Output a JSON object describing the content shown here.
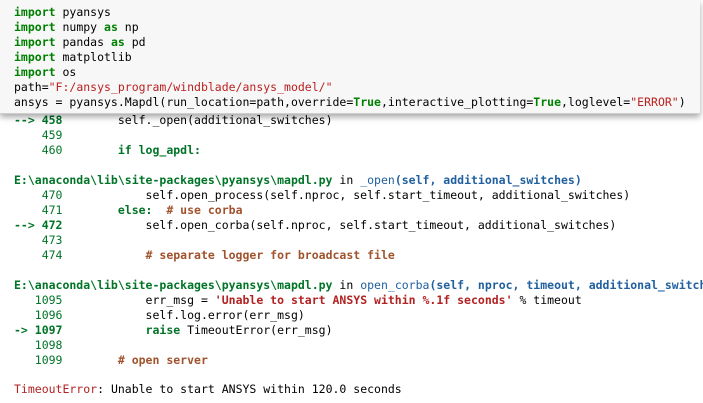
{
  "code_cell": {
    "lines": [
      {
        "kw": "import",
        "rest": " pyansys"
      },
      {
        "kw": "import",
        "rest": " numpy ",
        "kw2": "as",
        "rest2": " np"
      },
      {
        "kw": "import",
        "rest": " pandas ",
        "kw2": "as",
        "rest2": " pd"
      },
      {
        "kw": "import",
        "rest": " matplotlib"
      },
      {
        "kw": "import",
        "rest": " os"
      }
    ],
    "path_line": {
      "lhs": "path=",
      "str": "\"F:/ansys_program/windblade/ansys_model/\""
    },
    "mapdl_line": {
      "p1": "ansys = pyansys.Mapdl(run_location=path,override=",
      "c1": "True",
      "p2": ",interactive_plotting=",
      "c2": "True",
      "p3": ",loglevel=",
      "s1": "\"ERROR\"",
      "p4": ")"
    }
  },
  "traceback": {
    "frame0": {
      "partial_arrow": "--> 458",
      "partial_code": "        self._open(additional_switches)",
      "l459": "    459",
      "l460": "    460",
      "l460_code": "        if log_apdl:"
    },
    "frame1": {
      "path": "E:\\anaconda\\lib\\site-packages\\pyansys\\mapdl.py",
      "in": " in ",
      "func": "_open",
      "sig": "(self, additional_switches)",
      "l470": "    470",
      "l470_code": "            self.open_process(self.nproc, self.start_timeout, additional_switches)",
      "l471": "    471",
      "l471_kw": "        else:",
      "l471_comment": "  # use corba",
      "l472_arrow": "--> 472",
      "l472_code": "            self.open_corba(self.nproc, self.start_timeout, additional_switches)",
      "l473": "    473",
      "l474": "    474",
      "l474_comment": "            # separate logger for broadcast file"
    },
    "frame2": {
      "path": "E:\\anaconda\\lib\\site-packages\\pyansys\\mapdl.py",
      "in": " in ",
      "func": "open_corba",
      "sig": "(self, nproc, timeout, additional_switches)",
      "l1095": "   1095",
      "l1095_a": "            err_msg = ",
      "l1095_str": "'Unable to start ANSYS within %.1f seconds'",
      "l1095_b": " % timeout",
      "l1096": "   1096",
      "l1096_code": "            self.log.error(err_msg)",
      "l1097_arrow": "-> 1097",
      "l1097_kw": "            raise",
      "l1097_code": " TimeoutError(err_msg)",
      "l1098": "   1098",
      "l1099": "   1099",
      "l1099_comment": "        # open server"
    },
    "error": {
      "name": "TimeoutError",
      "message": ": Unable to start ANSYS within 120.0 seconds"
    }
  }
}
